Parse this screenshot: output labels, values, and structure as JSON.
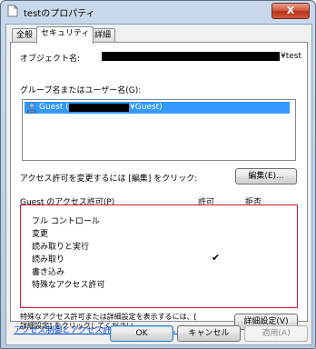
{
  "window": {
    "title": "testのプロパティ",
    "close_label": "X"
  },
  "tabs": [
    {
      "label": "全般"
    },
    {
      "label": "セキュリティ"
    },
    {
      "label": "詳細"
    }
  ],
  "security": {
    "object_name_label": "オブジェクト名:",
    "object_name_suffix": "¥test",
    "groups_label": "グループ名またはユーザー名(G):",
    "group_items": [
      {
        "prefix": "Guest (",
        "suffix": "¥Guest)"
      }
    ],
    "change_hint": "アクセス許可を変更するには [編集] をクリック:",
    "edit_button": "編集(E)...",
    "perm_title": "Guest のアクセス許可(P)",
    "allow_header": "許可",
    "deny_header": "拒否",
    "permissions": [
      {
        "name": "フル コントロール",
        "allow": false
      },
      {
        "name": "変更",
        "allow": false
      },
      {
        "name": "読み取りと実行",
        "allow": false
      },
      {
        "name": "読み取り",
        "allow": true
      },
      {
        "name": "書き込み",
        "allow": false
      },
      {
        "name": "特殊なアクセス許可",
        "allow": false
      }
    ],
    "allow_mark": "✔",
    "advanced_hint_line1": "特殊なアクセス許可または詳細設定を表示するには、[",
    "advanced_hint_line2": "詳細設定] をクリックしてください。",
    "advanced_button": "詳細設定(V)",
    "learn_link": "アクセス制御とアクセス許可の詳細を表示します。"
  },
  "footer": {
    "ok": "OK",
    "cancel": "キャンセル",
    "apply": "適用(A)"
  }
}
